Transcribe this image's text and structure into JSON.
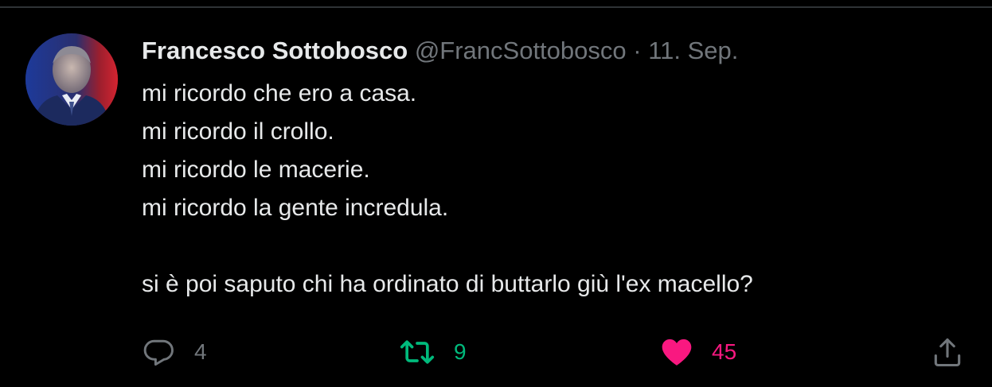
{
  "tweet": {
    "display_name": "Francesco Sottobosco",
    "handle": "@FrancSottobosco",
    "separator": "·",
    "date": "11. Sep.",
    "lines": [
      "mi ricordo che ero a casa.",
      "mi ricordo il crollo.",
      "mi ricordo le macerie.",
      "mi ricordo la gente incredula.",
      "",
      "si è poi saputo chi ha ordinato di buttarlo giù l'ex macello?"
    ]
  },
  "actions": {
    "reply_count": "4",
    "retweet_count": "9",
    "like_count": "45"
  },
  "icons": {
    "reply": "reply-icon",
    "retweet": "retweet-icon",
    "like": "heart-icon",
    "share": "share-icon"
  },
  "colors": {
    "background": "#000000",
    "text": "#e7e9ea",
    "muted": "#71767b",
    "retweet": "#00ba7c",
    "like": "#f91880"
  }
}
